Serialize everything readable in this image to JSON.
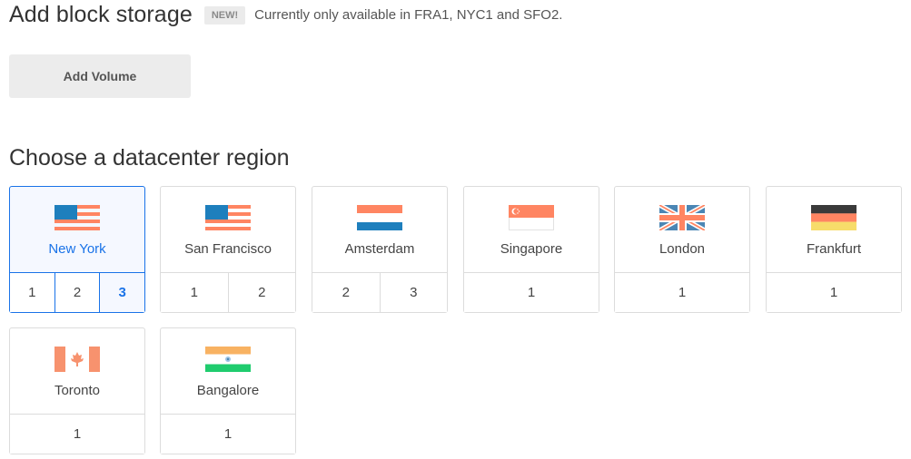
{
  "header": {
    "title": "Add block storage",
    "badge": "NEW!",
    "note": "Currently only available in FRA1, NYC1 and SFO2."
  },
  "add_volume_button": "Add Volume",
  "region_section": {
    "title": "Choose a datacenter region",
    "selected": {
      "region": "New York",
      "number": "3"
    },
    "accent_color": "#1a73e8",
    "regions": [
      {
        "name": "New York",
        "flag": "us-flag-icon",
        "numbers": [
          "1",
          "2",
          "3"
        ]
      },
      {
        "name": "San Francisco",
        "flag": "us-flag-icon",
        "numbers": [
          "1",
          "2"
        ]
      },
      {
        "name": "Amsterdam",
        "flag": "netherlands-flag-icon",
        "numbers": [
          "2",
          "3"
        ]
      },
      {
        "name": "Singapore",
        "flag": "singapore-flag-icon",
        "numbers": [
          "1"
        ]
      },
      {
        "name": "London",
        "flag": "uk-flag-icon",
        "numbers": [
          "1"
        ]
      },
      {
        "name": "Frankfurt",
        "flag": "germany-flag-icon",
        "numbers": [
          "1"
        ]
      },
      {
        "name": "Toronto",
        "flag": "canada-flag-icon",
        "numbers": [
          "1"
        ]
      },
      {
        "name": "Bangalore",
        "flag": "india-flag-icon",
        "numbers": [
          "1"
        ]
      }
    ]
  }
}
